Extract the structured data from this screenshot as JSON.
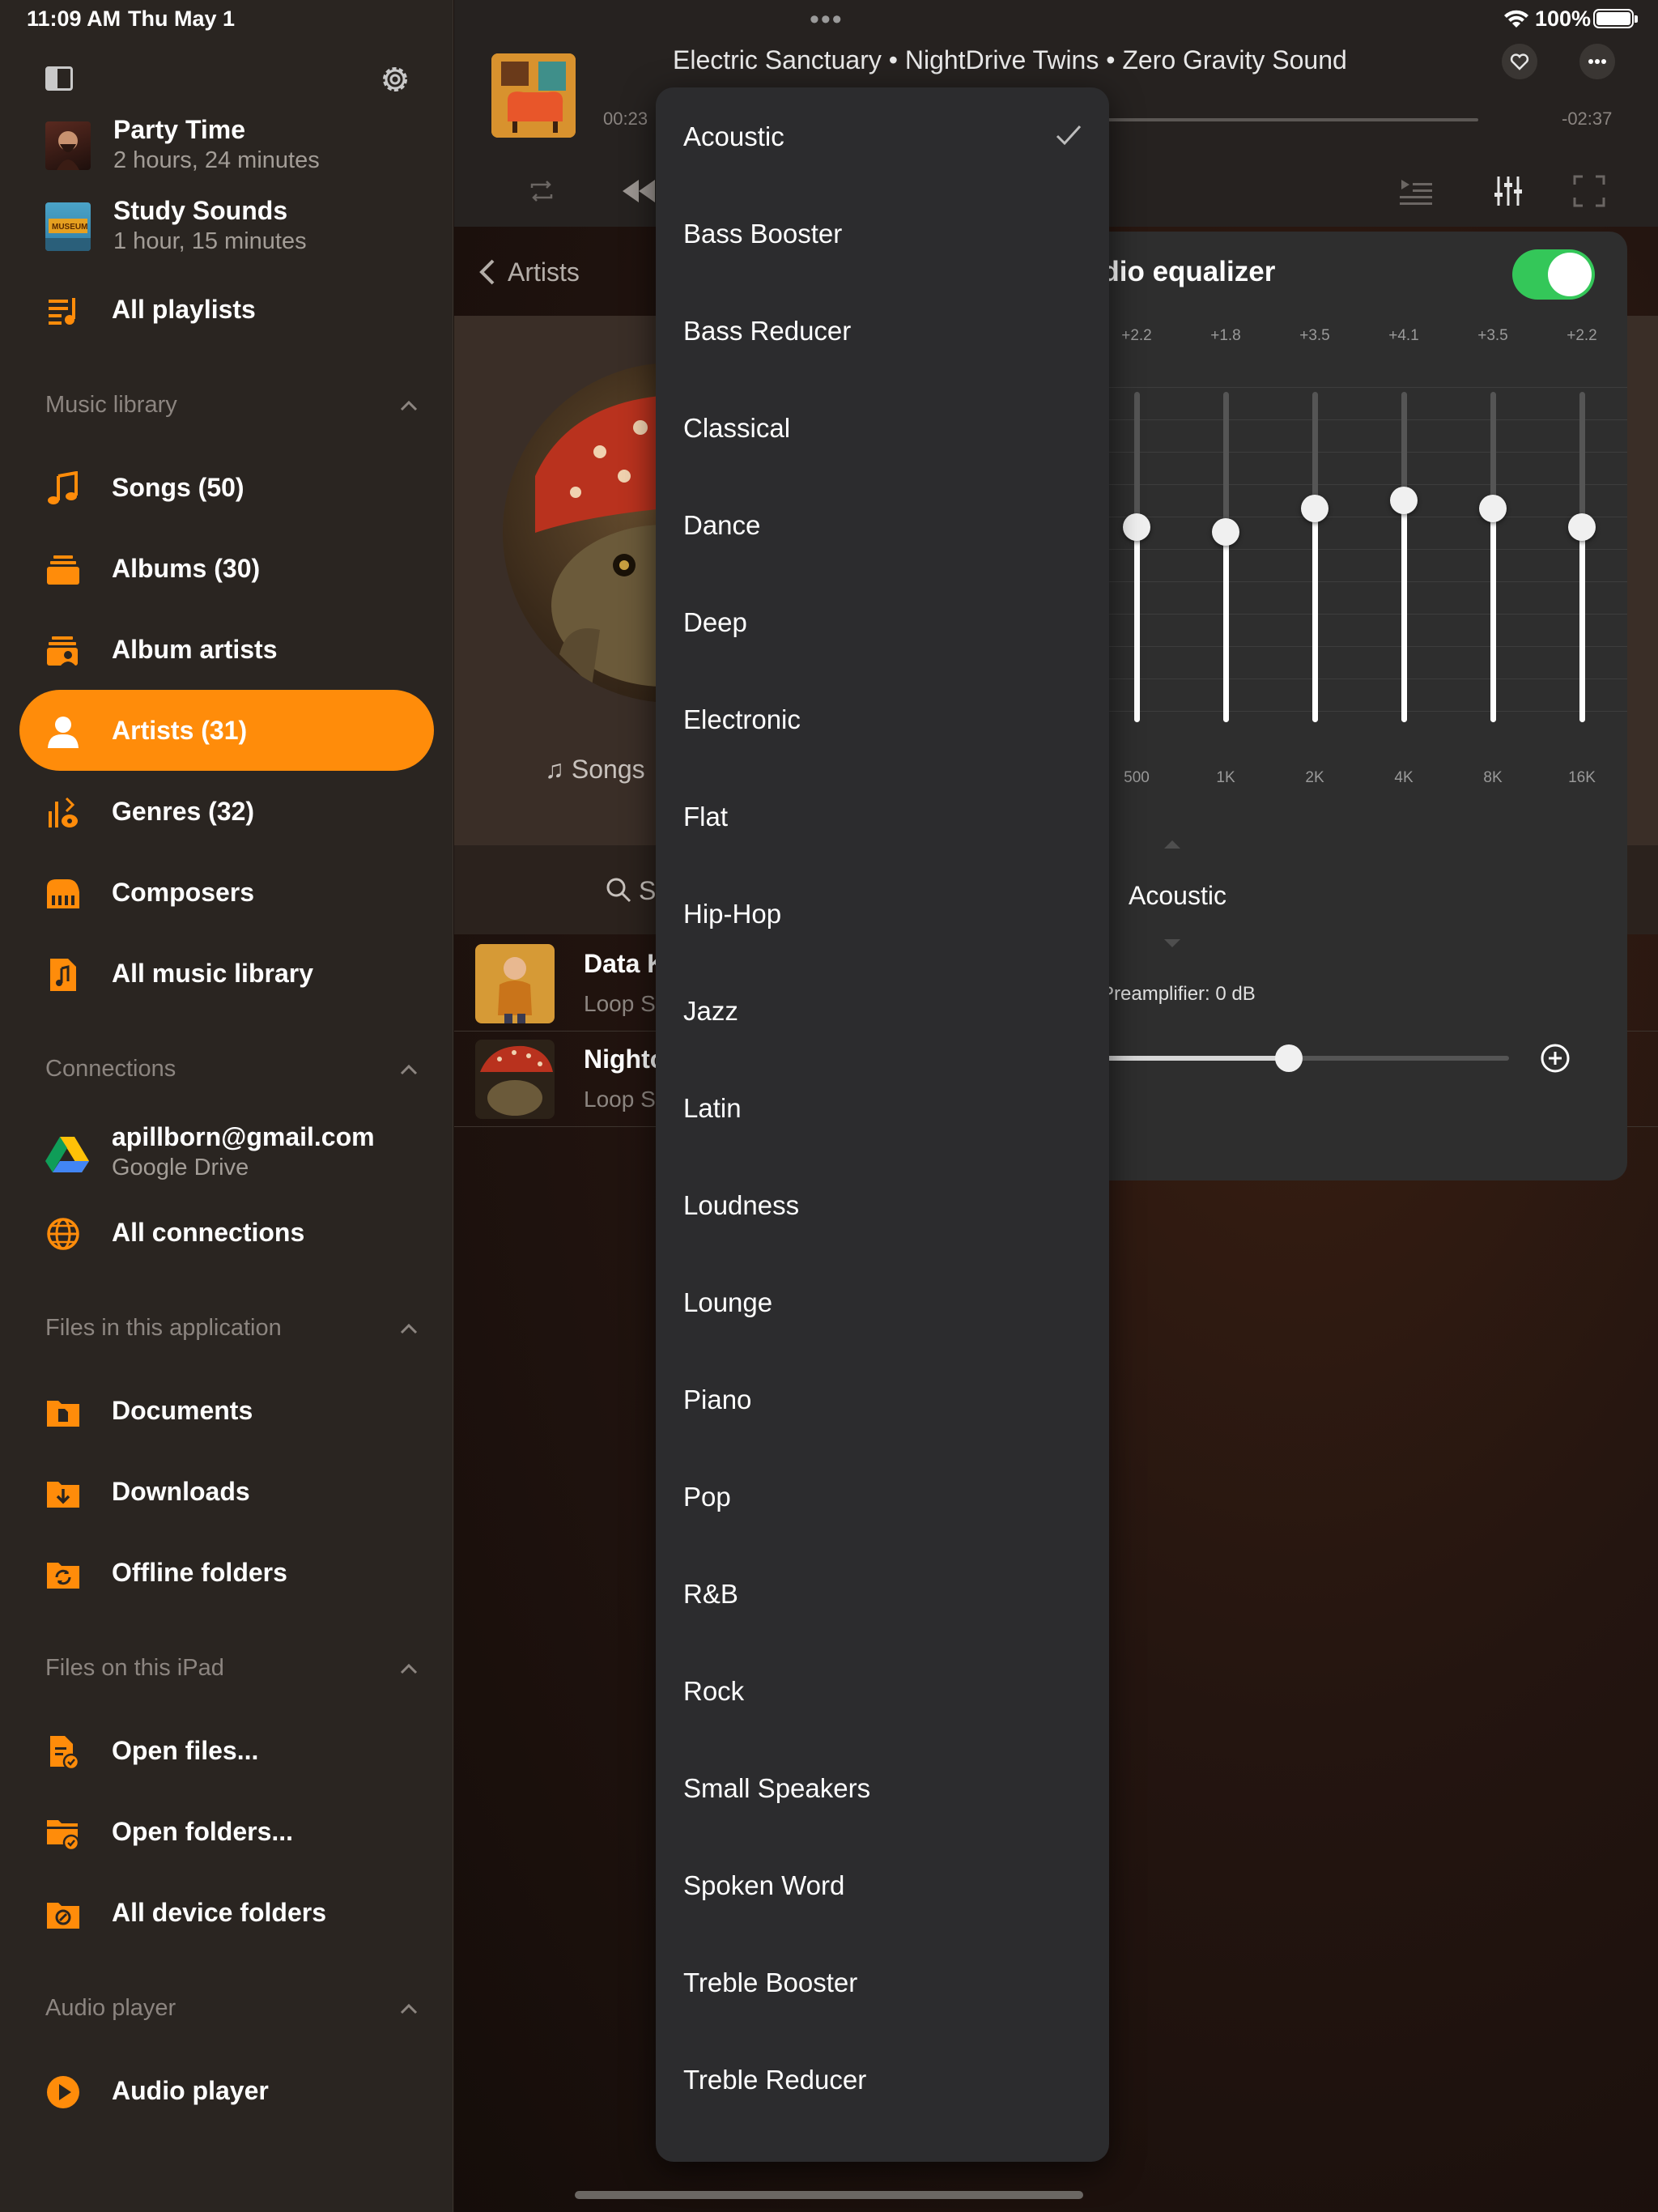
{
  "status_bar": {
    "time": "11:09 AM",
    "date": "Thu May 1",
    "battery": "100%"
  },
  "sidebar": {
    "playlists": [
      {
        "title": "Party Time",
        "subtitle": "2 hours, 24 minutes"
      },
      {
        "title": "Study Sounds",
        "subtitle": "1 hour, 15 minutes"
      }
    ],
    "all_playlists": "All playlists",
    "sections": {
      "music_library": "Music library",
      "connections": "Connections",
      "files_app": "Files in this application",
      "files_ipad": "Files on this iPad",
      "audio_player": "Audio player"
    },
    "music_items": [
      "Songs (50)",
      "Albums (30)",
      "Album artists",
      "Artists (31)",
      "Genres (32)",
      "Composers",
      "All music library"
    ],
    "connection_account": {
      "title": "apillborn@gmail.com",
      "subtitle": "Google Drive"
    },
    "all_connections": "All connections",
    "file_items": [
      "Documents",
      "Downloads",
      "Offline folders"
    ],
    "ipad_items": [
      "Open files...",
      "Open folders...",
      "All device folders"
    ],
    "audio_items": [
      "Audio player"
    ]
  },
  "now_playing": {
    "title": "Electric Sanctuary • NightDrive Twins • Zero Gravity Sound",
    "elapsed": "00:23",
    "remaining": "-02:37"
  },
  "breadcrumb": "Artists",
  "artist_view": {
    "tab": "Songs",
    "search_partial": "S",
    "songs": [
      {
        "title": "Data K",
        "subtitle": "Loop S"
      },
      {
        "title": "Nighto",
        "subtitle": "Loop S"
      }
    ]
  },
  "equalizer": {
    "title": "udio equalizer",
    "enabled": true,
    "bands": [
      {
        "freq": "500",
        "gain_label": "+2.2",
        "gain": 2.2
      },
      {
        "freq": "1K",
        "gain_label": "+1.8",
        "gain": 1.8
      },
      {
        "freq": "2K",
        "gain_label": "+3.5",
        "gain": 3.5
      },
      {
        "freq": "4K",
        "gain_label": "+4.1",
        "gain": 4.1
      },
      {
        "freq": "8K",
        "gain_label": "+3.5",
        "gain": 3.5
      },
      {
        "freq": "16K",
        "gain_label": "+2.2",
        "gain": 2.2
      }
    ],
    "preset": "Acoustic",
    "preamp_label": "Preamplifier: 0 dB",
    "preamp_fraction": 0.5
  },
  "preset_menu": {
    "selected": "Acoustic",
    "items": [
      "Acoustic",
      "Bass Booster",
      "Bass Reducer",
      "Classical",
      "Dance",
      "Deep",
      "Electronic",
      "Flat",
      "Hip-Hop",
      "Jazz",
      "Latin",
      "Loudness",
      "Lounge",
      "Piano",
      "Pop",
      "R&B",
      "Rock",
      "Small Speakers",
      "Spoken Word",
      "Treble Booster",
      "Treble Reducer"
    ]
  },
  "colors": {
    "accent": "#ff8c0a",
    "toggle_on": "#34c759",
    "panel": "#2e2e2e",
    "sidebar": "#2a2521"
  }
}
